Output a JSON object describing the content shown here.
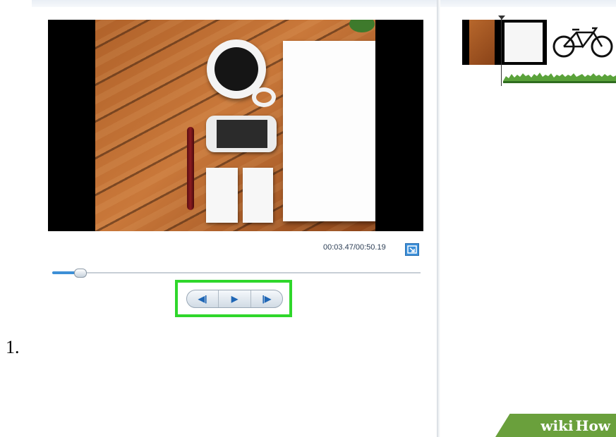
{
  "player": {
    "timecode": "00:03.47/00:50.19",
    "expand_icon": "expand-icon",
    "seek_progress": 0.07
  },
  "controls": {
    "prev_frame_icon": "previous-frame-icon",
    "play_icon": "play-icon",
    "next_frame_icon": "next-frame-icon",
    "prev_glyph": "◀|",
    "play_glyph": "▶",
    "next_glyph": "|▶",
    "highlight_color": "#2fd72b"
  },
  "step": {
    "number": "1."
  },
  "watermark": {
    "part1": "wiki",
    "part2": "How",
    "color": "#6aa03c"
  }
}
